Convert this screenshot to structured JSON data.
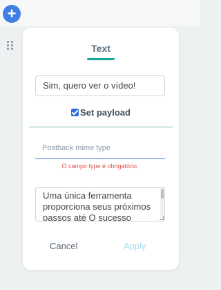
{
  "toolbar": {
    "add_icon": "plus-icon"
  },
  "sidebar": {
    "drag_icon": "drag-handle-icon"
  },
  "card": {
    "tab_label": "Text",
    "text_value": "Sim, quero ver o vídeo!",
    "checkbox_label": "Set payload",
    "checkbox_checked": true,
    "mime_placeholder": "Postback mime type",
    "error_message": "O campo type é obrigatório.",
    "textarea_value": "Uma única ferramenta proporciona seus próximos passos até O sucesso",
    "cancel_label": "Cancel",
    "apply_label": "Apply"
  },
  "colors": {
    "accent": "#17a89a",
    "primary": "#3f7fe3",
    "error": "#e0524a",
    "disabled": "#a7dcf2"
  }
}
